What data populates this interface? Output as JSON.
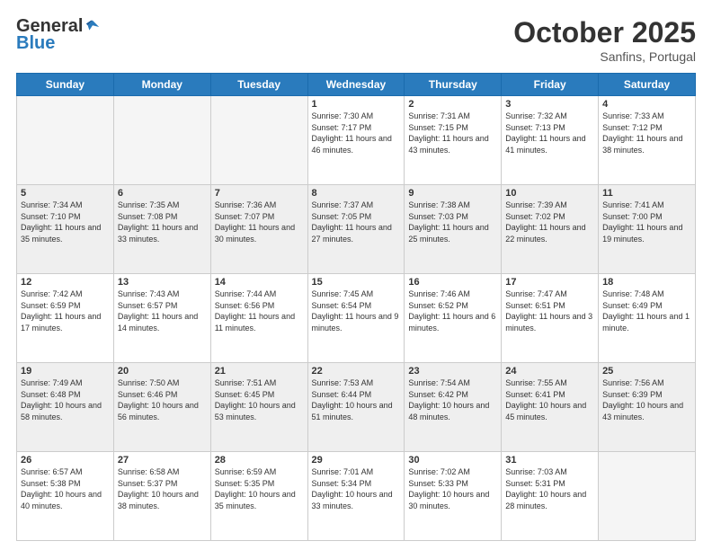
{
  "header": {
    "logo_general": "General",
    "logo_blue": "Blue",
    "month_title": "October 2025",
    "location": "Sanfins, Portugal"
  },
  "days_of_week": [
    "Sunday",
    "Monday",
    "Tuesday",
    "Wednesday",
    "Thursday",
    "Friday",
    "Saturday"
  ],
  "weeks": [
    [
      {
        "day": "",
        "sunrise": "",
        "sunset": "",
        "daylight": "",
        "empty": true
      },
      {
        "day": "",
        "sunrise": "",
        "sunset": "",
        "daylight": "",
        "empty": true
      },
      {
        "day": "",
        "sunrise": "",
        "sunset": "",
        "daylight": "",
        "empty": true
      },
      {
        "day": "1",
        "sunrise": "Sunrise: 7:30 AM",
        "sunset": "Sunset: 7:17 PM",
        "daylight": "Daylight: 11 hours and 46 minutes."
      },
      {
        "day": "2",
        "sunrise": "Sunrise: 7:31 AM",
        "sunset": "Sunset: 7:15 PM",
        "daylight": "Daylight: 11 hours and 43 minutes."
      },
      {
        "day": "3",
        "sunrise": "Sunrise: 7:32 AM",
        "sunset": "Sunset: 7:13 PM",
        "daylight": "Daylight: 11 hours and 41 minutes."
      },
      {
        "day": "4",
        "sunrise": "Sunrise: 7:33 AM",
        "sunset": "Sunset: 7:12 PM",
        "daylight": "Daylight: 11 hours and 38 minutes."
      }
    ],
    [
      {
        "day": "5",
        "sunrise": "Sunrise: 7:34 AM",
        "sunset": "Sunset: 7:10 PM",
        "daylight": "Daylight: 11 hours and 35 minutes."
      },
      {
        "day": "6",
        "sunrise": "Sunrise: 7:35 AM",
        "sunset": "Sunset: 7:08 PM",
        "daylight": "Daylight: 11 hours and 33 minutes."
      },
      {
        "day": "7",
        "sunrise": "Sunrise: 7:36 AM",
        "sunset": "Sunset: 7:07 PM",
        "daylight": "Daylight: 11 hours and 30 minutes."
      },
      {
        "day": "8",
        "sunrise": "Sunrise: 7:37 AM",
        "sunset": "Sunset: 7:05 PM",
        "daylight": "Daylight: 11 hours and 27 minutes."
      },
      {
        "day": "9",
        "sunrise": "Sunrise: 7:38 AM",
        "sunset": "Sunset: 7:03 PM",
        "daylight": "Daylight: 11 hours and 25 minutes."
      },
      {
        "day": "10",
        "sunrise": "Sunrise: 7:39 AM",
        "sunset": "Sunset: 7:02 PM",
        "daylight": "Daylight: 11 hours and 22 minutes."
      },
      {
        "day": "11",
        "sunrise": "Sunrise: 7:41 AM",
        "sunset": "Sunset: 7:00 PM",
        "daylight": "Daylight: 11 hours and 19 minutes."
      }
    ],
    [
      {
        "day": "12",
        "sunrise": "Sunrise: 7:42 AM",
        "sunset": "Sunset: 6:59 PM",
        "daylight": "Daylight: 11 hours and 17 minutes."
      },
      {
        "day": "13",
        "sunrise": "Sunrise: 7:43 AM",
        "sunset": "Sunset: 6:57 PM",
        "daylight": "Daylight: 11 hours and 14 minutes."
      },
      {
        "day": "14",
        "sunrise": "Sunrise: 7:44 AM",
        "sunset": "Sunset: 6:56 PM",
        "daylight": "Daylight: 11 hours and 11 minutes."
      },
      {
        "day": "15",
        "sunrise": "Sunrise: 7:45 AM",
        "sunset": "Sunset: 6:54 PM",
        "daylight": "Daylight: 11 hours and 9 minutes."
      },
      {
        "day": "16",
        "sunrise": "Sunrise: 7:46 AM",
        "sunset": "Sunset: 6:52 PM",
        "daylight": "Daylight: 11 hours and 6 minutes."
      },
      {
        "day": "17",
        "sunrise": "Sunrise: 7:47 AM",
        "sunset": "Sunset: 6:51 PM",
        "daylight": "Daylight: 11 hours and 3 minutes."
      },
      {
        "day": "18",
        "sunrise": "Sunrise: 7:48 AM",
        "sunset": "Sunset: 6:49 PM",
        "daylight": "Daylight: 11 hours and 1 minute."
      }
    ],
    [
      {
        "day": "19",
        "sunrise": "Sunrise: 7:49 AM",
        "sunset": "Sunset: 6:48 PM",
        "daylight": "Daylight: 10 hours and 58 minutes."
      },
      {
        "day": "20",
        "sunrise": "Sunrise: 7:50 AM",
        "sunset": "Sunset: 6:46 PM",
        "daylight": "Daylight: 10 hours and 56 minutes."
      },
      {
        "day": "21",
        "sunrise": "Sunrise: 7:51 AM",
        "sunset": "Sunset: 6:45 PM",
        "daylight": "Daylight: 10 hours and 53 minutes."
      },
      {
        "day": "22",
        "sunrise": "Sunrise: 7:53 AM",
        "sunset": "Sunset: 6:44 PM",
        "daylight": "Daylight: 10 hours and 51 minutes."
      },
      {
        "day": "23",
        "sunrise": "Sunrise: 7:54 AM",
        "sunset": "Sunset: 6:42 PM",
        "daylight": "Daylight: 10 hours and 48 minutes."
      },
      {
        "day": "24",
        "sunrise": "Sunrise: 7:55 AM",
        "sunset": "Sunset: 6:41 PM",
        "daylight": "Daylight: 10 hours and 45 minutes."
      },
      {
        "day": "25",
        "sunrise": "Sunrise: 7:56 AM",
        "sunset": "Sunset: 6:39 PM",
        "daylight": "Daylight: 10 hours and 43 minutes."
      }
    ],
    [
      {
        "day": "26",
        "sunrise": "Sunrise: 6:57 AM",
        "sunset": "Sunset: 5:38 PM",
        "daylight": "Daylight: 10 hours and 40 minutes."
      },
      {
        "day": "27",
        "sunrise": "Sunrise: 6:58 AM",
        "sunset": "Sunset: 5:37 PM",
        "daylight": "Daylight: 10 hours and 38 minutes."
      },
      {
        "day": "28",
        "sunrise": "Sunrise: 6:59 AM",
        "sunset": "Sunset: 5:35 PM",
        "daylight": "Daylight: 10 hours and 35 minutes."
      },
      {
        "day": "29",
        "sunrise": "Sunrise: 7:01 AM",
        "sunset": "Sunset: 5:34 PM",
        "daylight": "Daylight: 10 hours and 33 minutes."
      },
      {
        "day": "30",
        "sunrise": "Sunrise: 7:02 AM",
        "sunset": "Sunset: 5:33 PM",
        "daylight": "Daylight: 10 hours and 30 minutes."
      },
      {
        "day": "31",
        "sunrise": "Sunrise: 7:03 AM",
        "sunset": "Sunset: 5:31 PM",
        "daylight": "Daylight: 10 hours and 28 minutes."
      },
      {
        "day": "",
        "sunrise": "",
        "sunset": "",
        "daylight": "",
        "empty": true
      }
    ]
  ]
}
